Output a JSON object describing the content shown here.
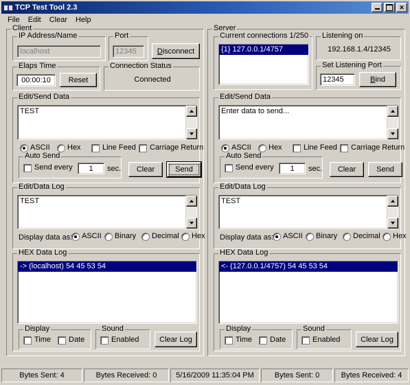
{
  "window": {
    "title": "TCP Test Tool 2.3",
    "icon": "plug-connector-icon",
    "minimize_label": "",
    "maximize_label": "",
    "close_label": "✕"
  },
  "menu": {
    "items": [
      {
        "label": "File"
      },
      {
        "label": "Edit"
      },
      {
        "label": "Clear"
      },
      {
        "label": "Help"
      }
    ]
  },
  "client": {
    "group_label": "Client",
    "ip": {
      "group_label": "IP Address/Name",
      "value": "localhost"
    },
    "port": {
      "group_label": "Port",
      "value": "12345"
    },
    "disconnect_button": {
      "label_prefix": "D",
      "label_rest": "isconnect"
    },
    "elapsed": {
      "group_label": "Elaps Time",
      "value": "00:00:10",
      "reset_label": "Reset"
    },
    "status": {
      "group_label": "Connection Status",
      "value": "Connected"
    },
    "send": {
      "group_label": "Edit/Send Data",
      "value": "TEST",
      "format_ascii": "ASCII",
      "format_hex": "Hex",
      "line_feed": "Line Feed",
      "carriage_return": "Carriage Return",
      "auto_send_label": "Auto Send",
      "send_every_label": "Send every",
      "interval_value": "1",
      "sec_label": "sec.",
      "clear_label": "Clear",
      "send_label": "Send"
    },
    "datalog": {
      "group_label": "Edit/Data Log",
      "value": "TEST",
      "display_as_label": "Display data as:",
      "opt_ascii": "ASCII",
      "opt_binary": "Binary",
      "opt_decimal": "Decimal",
      "opt_hex": "Hex"
    },
    "hexlog": {
      "group_label": "HEX Data Log",
      "rows": [
        {
          "text": "-> (localhost) 54 45 53 54",
          "selected": true
        }
      ],
      "display_label": "Display",
      "time_label": "Time",
      "date_label": "Date",
      "sound_label": "Sound",
      "enabled_label": "Enabled",
      "clear_log_label": "Clear Log"
    }
  },
  "server": {
    "group_label": "Server",
    "connections": {
      "group_label": "Current connections 1/250",
      "rows": [
        {
          "text": "{1} 127.0.0.1/4757",
          "selected": true
        }
      ]
    },
    "listening": {
      "group_label": "Listening on",
      "value": "192.168.1.4/12345"
    },
    "listen_port": {
      "group_label": "Set Listening Port",
      "value": "12345",
      "bind_prefix": "B",
      "bind_rest": "ind"
    },
    "send": {
      "group_label": "Edit/Send Data",
      "value": "Enter data to send...",
      "format_ascii": "ASCII",
      "format_hex": "Hex",
      "line_feed": "Line Feed",
      "carriage_return": "Carriage Return",
      "auto_send_label": "Auto Send",
      "send_every_label": "Send every",
      "interval_value": "1",
      "sec_label": "sec.",
      "clear_label": "Clear",
      "send_label": "Send"
    },
    "datalog": {
      "group_label": "Edit/Data Log",
      "value": "TEST",
      "display_as_label": "Display data as:",
      "opt_ascii": "ASCII",
      "opt_binary": "Binary",
      "opt_decimal": "Decimal",
      "opt_hex": "Hex"
    },
    "hexlog": {
      "group_label": "HEX Data Log",
      "rows": [
        {
          "text": "<- (127.0.0.1/4757) 54 45 53 54",
          "selected": true
        }
      ],
      "display_label": "Display",
      "time_label": "Time",
      "date_label": "Date",
      "sound_label": "Sound",
      "enabled_label": "Enabled",
      "clear_log_label": "Clear Log"
    }
  },
  "statusbar": {
    "panels": [
      "Bytes Sent: 4",
      "Bytes Received: 0",
      "5/16/2009 11:35:04 PM",
      "Bytes Sent: 0",
      "Bytes Received: 4"
    ]
  },
  "colors": {
    "window_face": "#d4d0c8",
    "selection_blue": "#000080",
    "title_blue": "#0a246a"
  }
}
